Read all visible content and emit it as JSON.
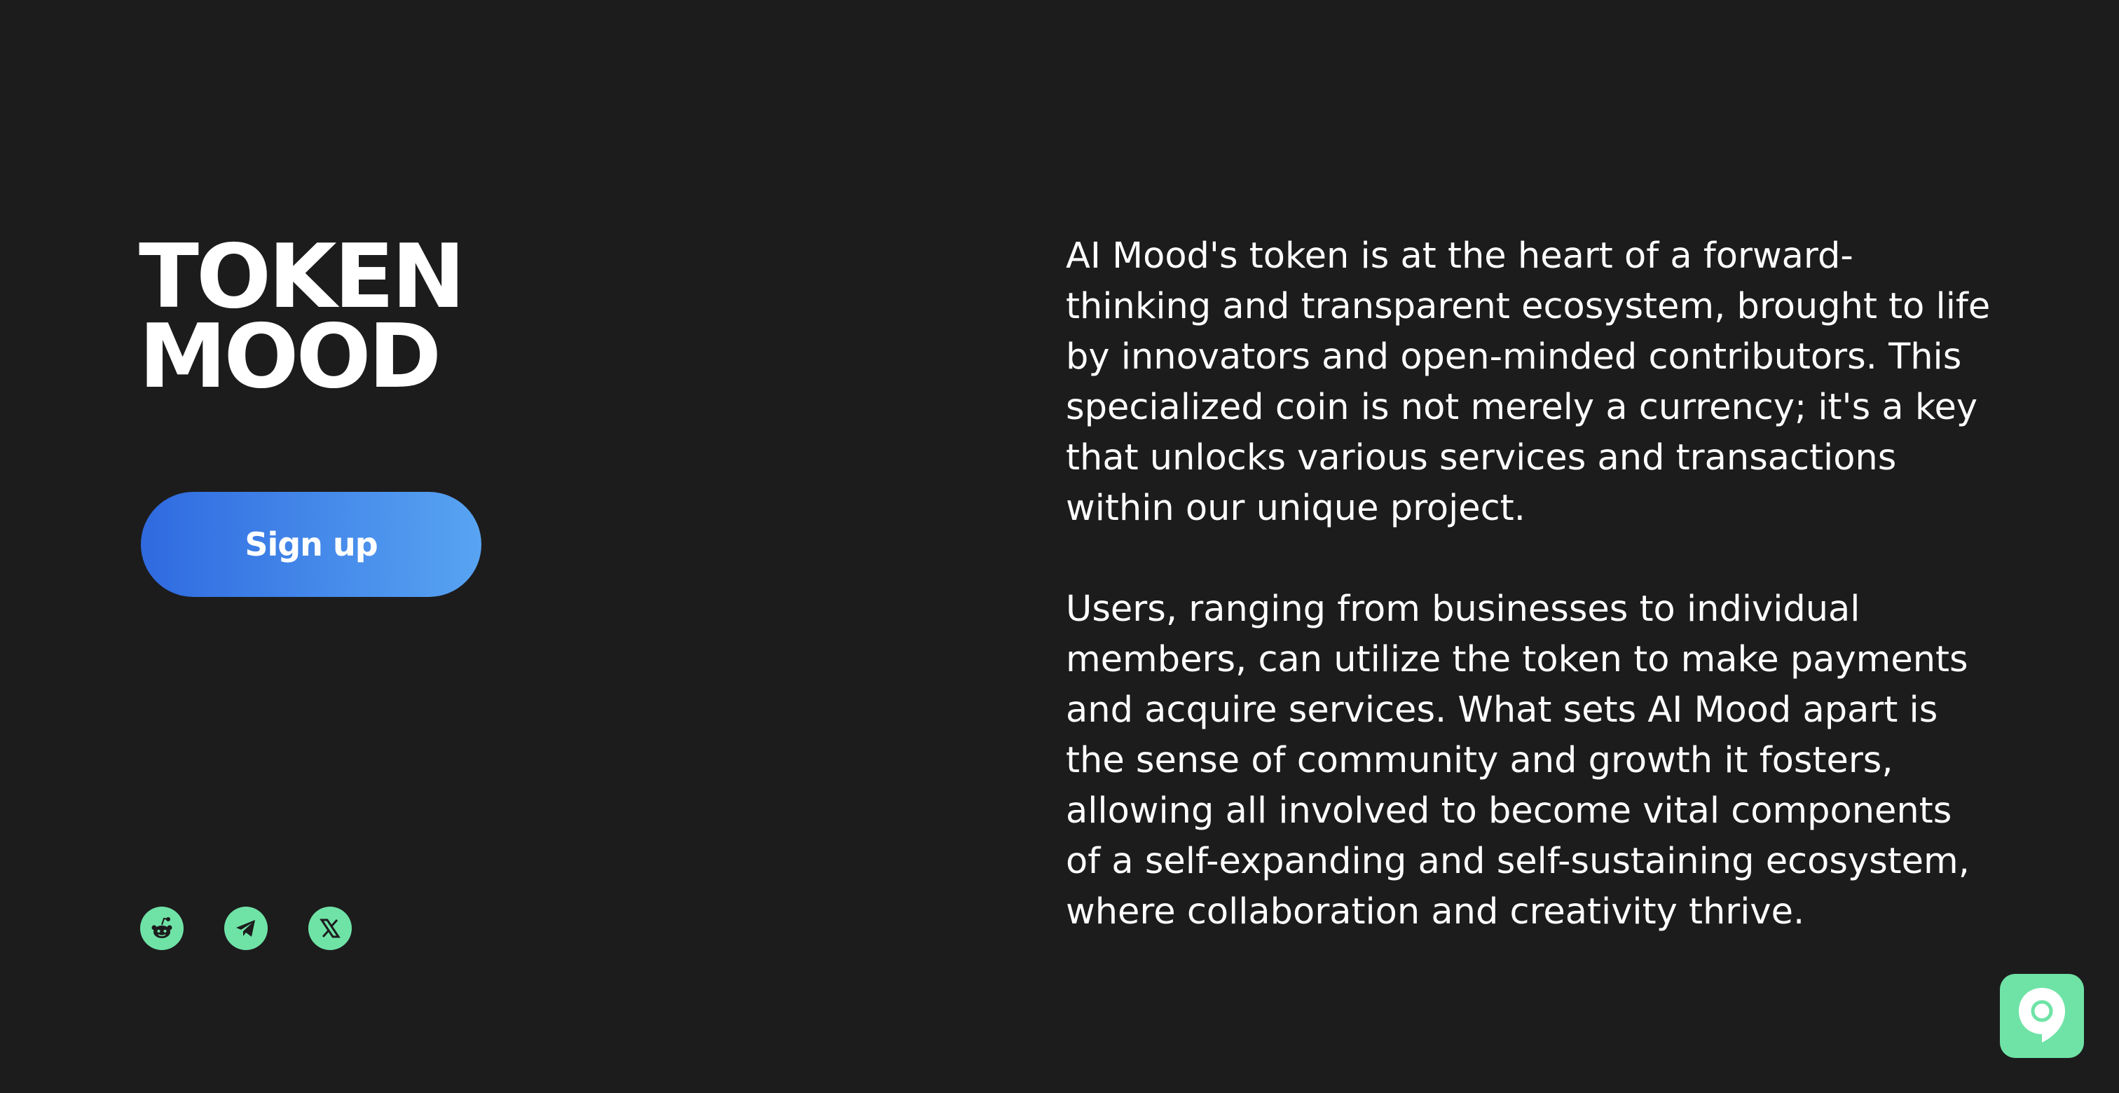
{
  "hero": {
    "title": "TOKEN\nMOOD",
    "signup_label": "Sign up"
  },
  "socials": [
    {
      "icon": "reddit-icon"
    },
    {
      "icon": "telegram-icon"
    },
    {
      "icon": "x-icon"
    }
  ],
  "content": {
    "paragraph_1": "AI Mood's token is at the heart of a forward-thinking and transparent ecosystem, brought to life by innovators and open-minded contributors. This specialized coin is not merely a currency; it's a key that unlocks various services and transactions within our unique project.",
    "paragraph_2": "Users, ranging from businesses to individual members, can utilize the token to make payments and acquire services. What sets AI Mood apart is the sense of community and growth it fosters, allowing all involved to become vital components of a self-expanding and self-sustaining ecosystem, where collaboration and creativity thrive."
  },
  "chat_widget": {
    "icon": "chat-bubble-icon"
  },
  "colors": {
    "background": "#1c1c1d",
    "accent_green": "#6fe3a6",
    "button_gradient_start": "#2f6ae0",
    "button_gradient_end": "#58a4f2",
    "text": "#ffffff"
  }
}
